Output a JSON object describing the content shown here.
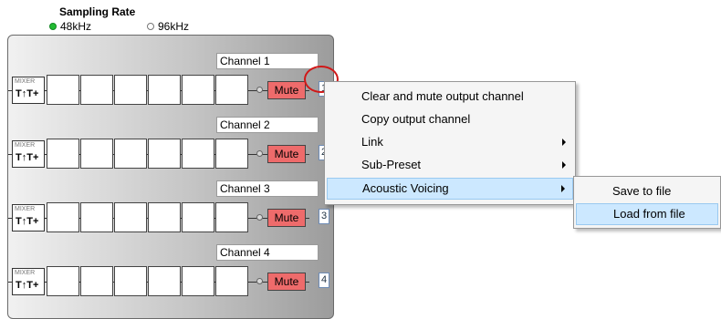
{
  "sampling_rate": {
    "title": "Sampling Rate",
    "options": [
      {
        "label": "48kHz",
        "selected": true
      },
      {
        "label": "96kHz",
        "selected": false
      }
    ]
  },
  "mixer": {
    "tag": "MIXER",
    "symbol": "T↑T+"
  },
  "channels": [
    {
      "name": "Channel 1",
      "mute_label": "Mute",
      "number": "1"
    },
    {
      "name": "Channel 2",
      "mute_label": "Mute",
      "number": "2"
    },
    {
      "name": "Channel 3",
      "mute_label": "Mute",
      "number": "3"
    },
    {
      "name": "Channel 4",
      "mute_label": "Mute",
      "number": "4"
    }
  ],
  "context_menu": {
    "items": [
      {
        "label": "Clear and mute output channel",
        "submenu": false
      },
      {
        "label": "Copy output channel",
        "submenu": false
      },
      {
        "label": "Link",
        "submenu": true
      },
      {
        "label": "Sub-Preset",
        "submenu": true
      },
      {
        "label": "Acoustic Voicing",
        "submenu": true,
        "highlighted": true
      }
    ]
  },
  "submenu": {
    "items": [
      {
        "label": "Save to file"
      },
      {
        "label": "Load from file",
        "highlighted": true
      }
    ]
  },
  "colors": {
    "mute_button": "#ee6b6b",
    "selected_radio": "#22bb33",
    "menu_highlight": "#cce8ff",
    "annotation_circle": "#d01818"
  },
  "icons": {
    "radio_selected": "radio-selected-icon",
    "radio_unselected": "radio-unselected-icon",
    "submenu_arrow": "submenu-arrow-icon"
  }
}
